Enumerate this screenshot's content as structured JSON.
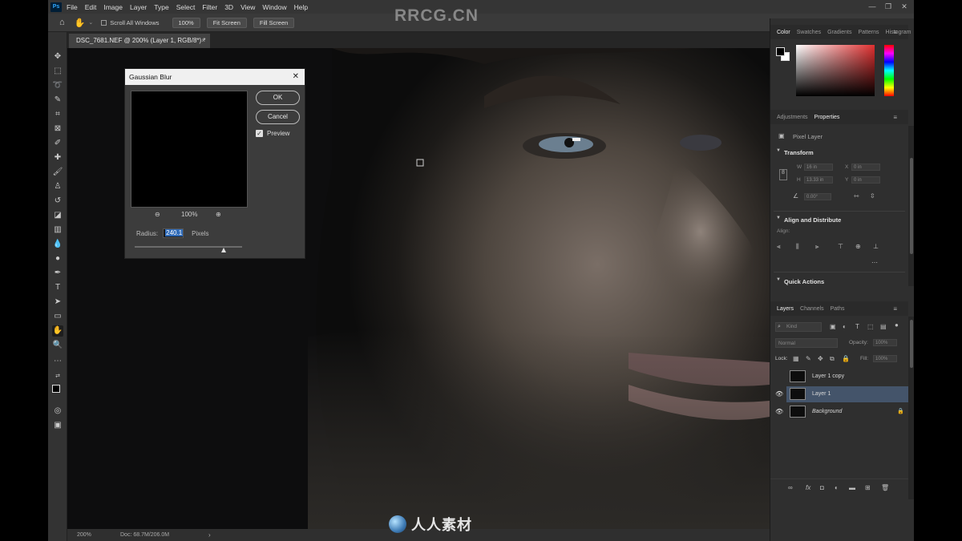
{
  "watermark": "RRCG.CN",
  "bottom_logo": "人人素材",
  "menubar": {
    "items": [
      "File",
      "Edit",
      "Image",
      "Layer",
      "Type",
      "Select",
      "Filter",
      "3D",
      "View",
      "Window",
      "Help"
    ]
  },
  "options": {
    "scroll_all_windows": "Scroll All Windows",
    "zoom": "100%",
    "fit_screen": "Fit Screen",
    "fill_screen": "Fill Screen"
  },
  "document": {
    "tab_title": "DSC_7681.NEF @ 200% (Layer 1, RGB/8*) *",
    "status_zoom": "200%",
    "status_doc": "Doc: 68.7M/206.0M"
  },
  "dialog": {
    "title": "Gaussian Blur",
    "ok": "OK",
    "cancel": "Cancel",
    "preview_label": "Preview",
    "preview_checked": true,
    "zoom": "100%",
    "radius_label": "Radius:",
    "radius_value": "240.1",
    "unit": "Pixels"
  },
  "color_panel": {
    "tabs": [
      "Color",
      "Swatches",
      "Gradients",
      "Patterns",
      "Histogram"
    ],
    "hue_color": "#e03030"
  },
  "properties_panel": {
    "tabs": [
      "Adjustments",
      "Properties"
    ],
    "layer_type": "Pixel Layer",
    "transform_title": "Transform",
    "fields": [
      "W",
      "H",
      "X",
      "Y"
    ],
    "field_values": [
      "16 in",
      "0 in",
      "13.33 in",
      "0 in"
    ],
    "angle": "0.00°",
    "align_title": "Align and Distribute",
    "align_label": "Align:",
    "quick_actions": "Quick Actions"
  },
  "layers_panel": {
    "tabs": [
      "Layers",
      "Channels",
      "Paths"
    ],
    "kind": "Kind",
    "blend_mode": "Normal",
    "opacity_label": "Opacity:",
    "opacity_value": "100%",
    "lock_label": "Lock:",
    "fill_label": "Fill:",
    "fill_value": "100%",
    "layers": [
      {
        "name": "Layer 1 copy",
        "visible": false,
        "selected": false
      },
      {
        "name": "Layer 1",
        "visible": true,
        "selected": true
      },
      {
        "name": "Background",
        "visible": true,
        "selected": false,
        "locked": true
      }
    ]
  }
}
